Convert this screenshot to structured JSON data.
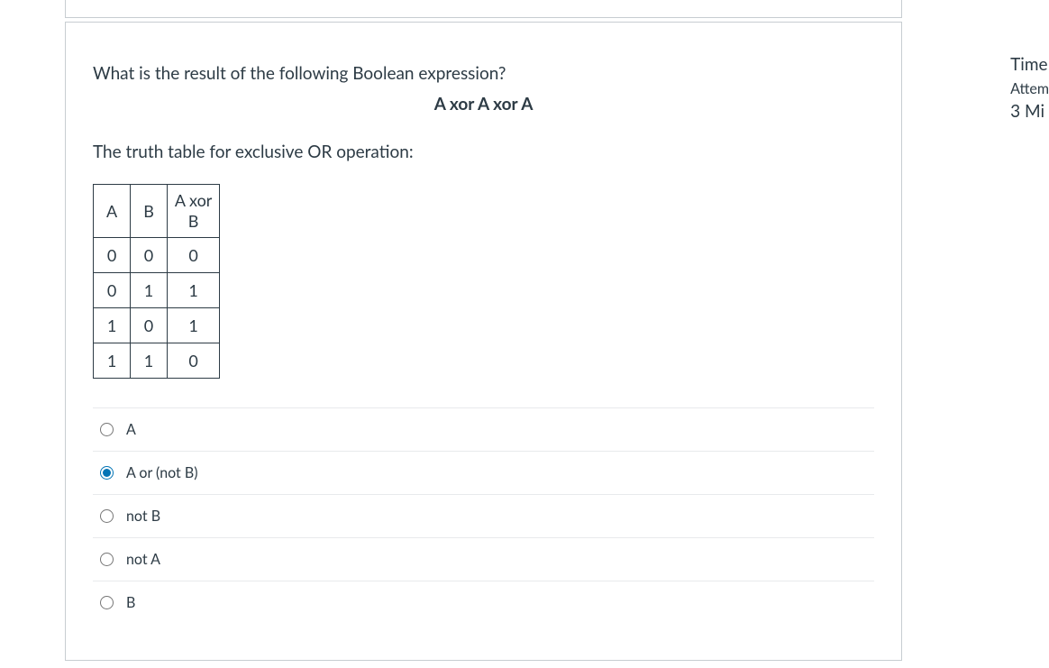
{
  "question": {
    "prompt": "What is the result of the following Boolean expression?",
    "expression": "A xor A xor A",
    "truth_label": "The truth table for exclusive OR operation:",
    "table": {
      "headers": {
        "a": "A",
        "b": "B",
        "axorb_line1": "A xor",
        "axorb_line2": "B"
      },
      "rows": [
        {
          "a": "0",
          "b": "0",
          "r": "0"
        },
        {
          "a": "0",
          "b": "1",
          "r": "1"
        },
        {
          "a": "1",
          "b": "0",
          "r": "1"
        },
        {
          "a": "1",
          "b": "1",
          "r": "0"
        }
      ]
    },
    "options": [
      {
        "label": "A",
        "selected": false
      },
      {
        "label": "A or (not B)",
        "selected": true
      },
      {
        "label": "not B",
        "selected": false
      },
      {
        "label": "not A",
        "selected": false
      },
      {
        "label": "B",
        "selected": false
      }
    ]
  },
  "sidebar": {
    "title": "Time",
    "attempt": "Attem",
    "remaining": "3 Mi"
  }
}
